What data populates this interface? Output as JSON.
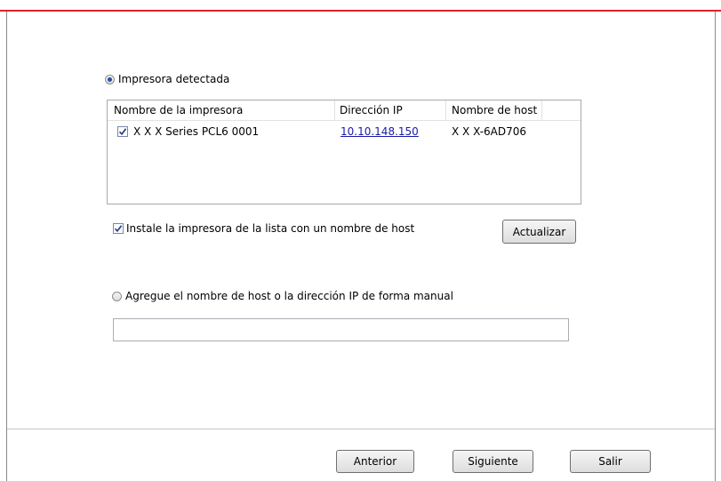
{
  "detected_option": {
    "label": "Impresora detectada",
    "selected": true
  },
  "printer_list": {
    "columns": [
      "Nombre de la impresora",
      "Dirección IP",
      "Nombre de host"
    ],
    "rows": [
      {
        "checked": true,
        "name": "X X X  Series PCL6 0001",
        "ip": "10.10.148.150",
        "host": "X X X-6AD706"
      }
    ]
  },
  "install_by_hostname": {
    "label": "Instale la impresora de la lista con un nombre de host",
    "checked": true
  },
  "refresh_button": {
    "label": "Actualizar"
  },
  "manual_option": {
    "label": "Agregue el nombre de host o la dirección IP de forma manual",
    "selected": false
  },
  "manual_input": {
    "value": ""
  },
  "footer": {
    "back_label": "Anterior",
    "next_label": "Siguiente",
    "exit_label": "Salir"
  },
  "colors": {
    "accent_border": "#d9262b",
    "link": "#1a1aa6",
    "radio_dot": "#1f4fa6"
  }
}
